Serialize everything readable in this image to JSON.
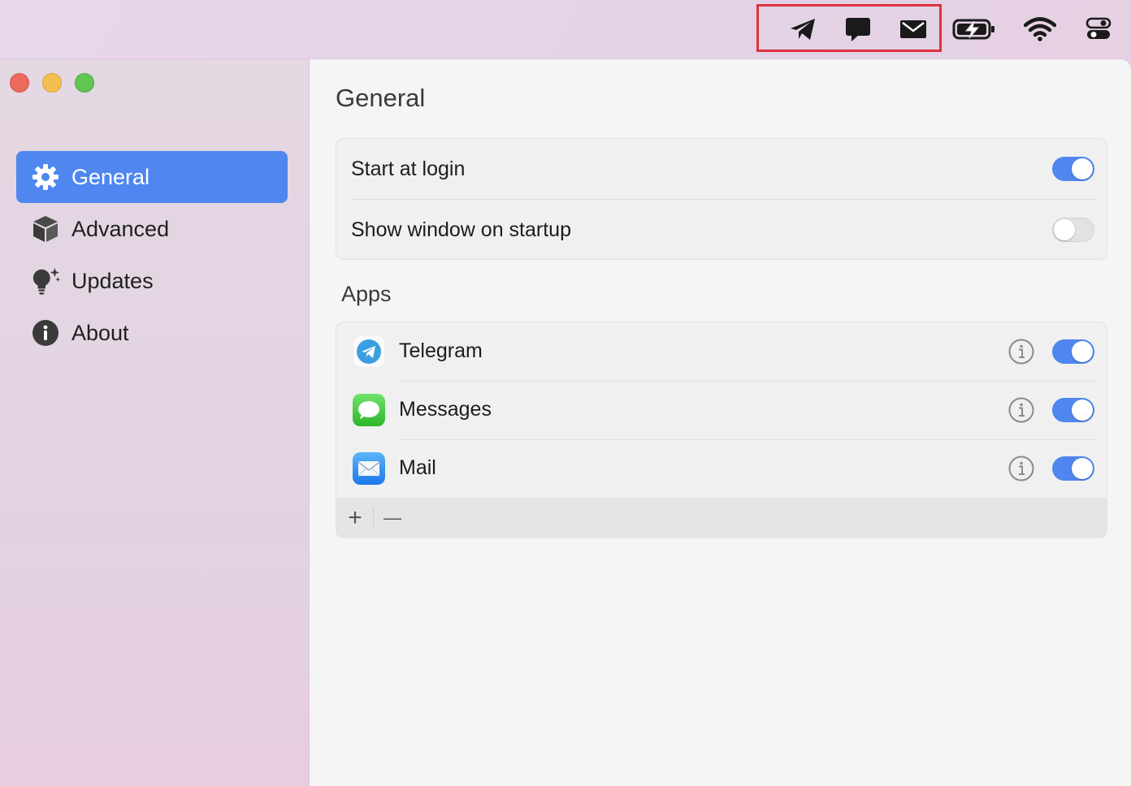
{
  "menubar": {
    "icons": [
      "telegram-menubar-icon",
      "messages-menubar-icon",
      "mail-menubar-icon",
      "battery-charging-icon",
      "wifi-icon",
      "control-center-icon"
    ]
  },
  "sidebar": {
    "items": [
      {
        "label": "General",
        "icon": "gear-icon",
        "active": true
      },
      {
        "label": "Advanced",
        "icon": "cube-icon",
        "active": false
      },
      {
        "label": "Updates",
        "icon": "lightbulb-sparkle-icon",
        "active": false
      },
      {
        "label": "About",
        "icon": "info-circle-icon",
        "active": false
      }
    ]
  },
  "main": {
    "title": "General",
    "settings": [
      {
        "label": "Start at login",
        "enabled": true
      },
      {
        "label": "Show window on startup",
        "enabled": false
      }
    ],
    "apps_section": "Apps",
    "apps": [
      {
        "name": "Telegram",
        "enabled": true
      },
      {
        "name": "Messages",
        "enabled": true
      },
      {
        "name": "Mail",
        "enabled": true
      }
    ],
    "footer": {
      "add": "+",
      "remove": "—"
    }
  },
  "colors": {
    "accent": "#4f86ef",
    "highlight": "#e0323b"
  }
}
